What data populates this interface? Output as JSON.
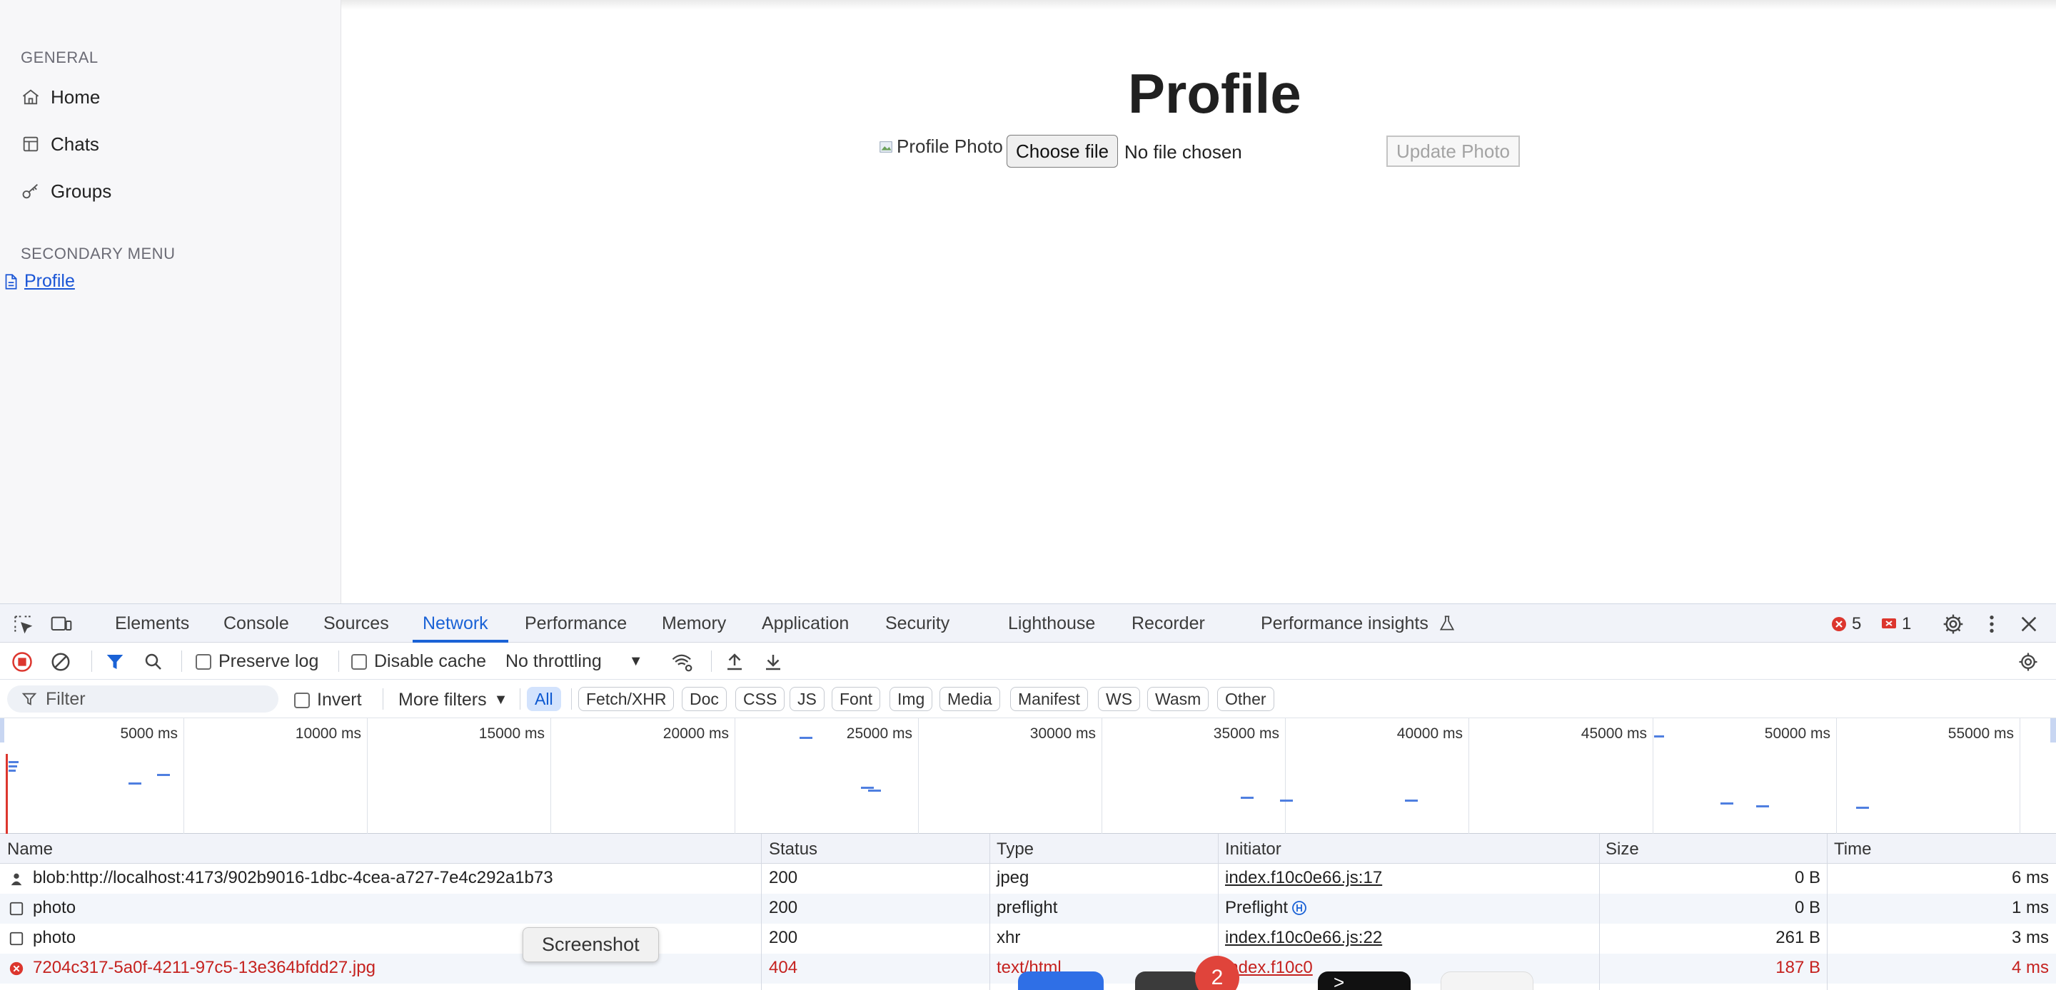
{
  "sidebar": {
    "general_heading": "GENERAL",
    "items": [
      {
        "label": "Home",
        "icon": "home-icon"
      },
      {
        "label": "Chats",
        "icon": "table-icon"
      },
      {
        "label": "Groups",
        "icon": "key-icon"
      }
    ],
    "secondary_heading": "SECONDARY MENU",
    "profile_link": "Profile"
  },
  "main": {
    "title": "Profile",
    "photo_alt": "Profile Photo",
    "choose_file": "Choose file",
    "no_file": "No file chosen",
    "update_photo": "Update Photo"
  },
  "devtools": {
    "tabs": [
      "Elements",
      "Console",
      "Sources",
      "Network",
      "Performance",
      "Memory",
      "Application",
      "Security",
      "Lighthouse",
      "Recorder",
      "Performance insights"
    ],
    "active_tab": "Network",
    "errors_count": "5",
    "issues_count": "1",
    "toolbar": {
      "preserve_log": "Preserve log",
      "disable_cache": "Disable cache",
      "throttling": "No throttling"
    },
    "filter": {
      "placeholder": "Filter",
      "invert": "Invert",
      "more_filters": "More filters",
      "chips": [
        "All",
        "Fetch/XHR",
        "Doc",
        "CSS",
        "JS",
        "Font",
        "Img",
        "Media",
        "Manifest",
        "WS",
        "Wasm",
        "Other"
      ],
      "selected_chip": "All"
    },
    "timeline_ticks": [
      "5000 ms",
      "10000 ms",
      "15000 ms",
      "20000 ms",
      "25000 ms",
      "30000 ms",
      "35000 ms",
      "40000 ms",
      "45000 ms",
      "50000 ms",
      "55000 ms"
    ],
    "table": {
      "columns": [
        "Name",
        "Status",
        "Type",
        "Initiator",
        "Size",
        "Time"
      ],
      "rows": [
        {
          "name": "blob:http://localhost:4173/902b9016-1dbc-4cea-a727-7e4c292a1b73",
          "status": "200",
          "type": "jpeg",
          "initiator": "index.f10c0e66.js:17",
          "size": "0 B",
          "time": "6 ms",
          "icon": "image-icon"
        },
        {
          "name": "photo",
          "status": "200",
          "type": "preflight",
          "initiator": "Preflight",
          "size": "0 B",
          "time": "1 ms",
          "icon": "document-icon"
        },
        {
          "name": "photo",
          "status": "200",
          "type": "xhr",
          "initiator": "index.f10c0e66.js:22",
          "size": "261 B",
          "time": "3 ms",
          "icon": "document-icon"
        },
        {
          "name": "7204c317-5a0f-4211-97c5-13e364bfdd27.jpg",
          "status": "404",
          "type": "text/html",
          "initiator": "index.f10c0",
          "size": "187 B",
          "time": "4 ms",
          "icon": "error-icon"
        }
      ]
    }
  },
  "tooltip": "Screenshot",
  "dock_badge": "2",
  "colors": {
    "accent": "#1a62d6",
    "error": "#c5221f",
    "link": "#1a55d6"
  }
}
